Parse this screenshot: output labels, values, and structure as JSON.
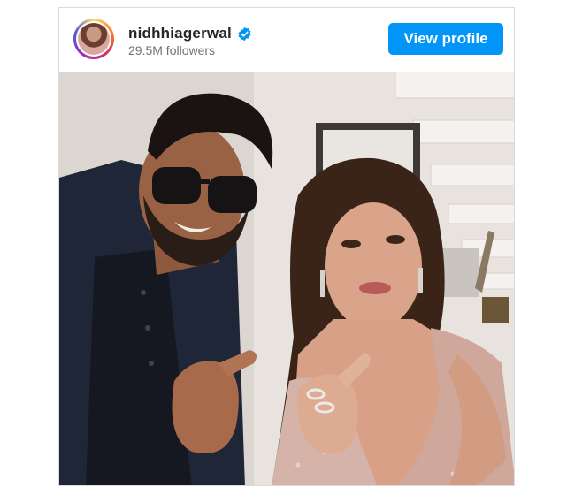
{
  "post": {
    "username": "nidhhiagerwal",
    "followers": "29.5M followers",
    "view_profile_label": "View profile",
    "verified_icon": "verified-badge-icon",
    "accent_color": "#0095f6"
  }
}
